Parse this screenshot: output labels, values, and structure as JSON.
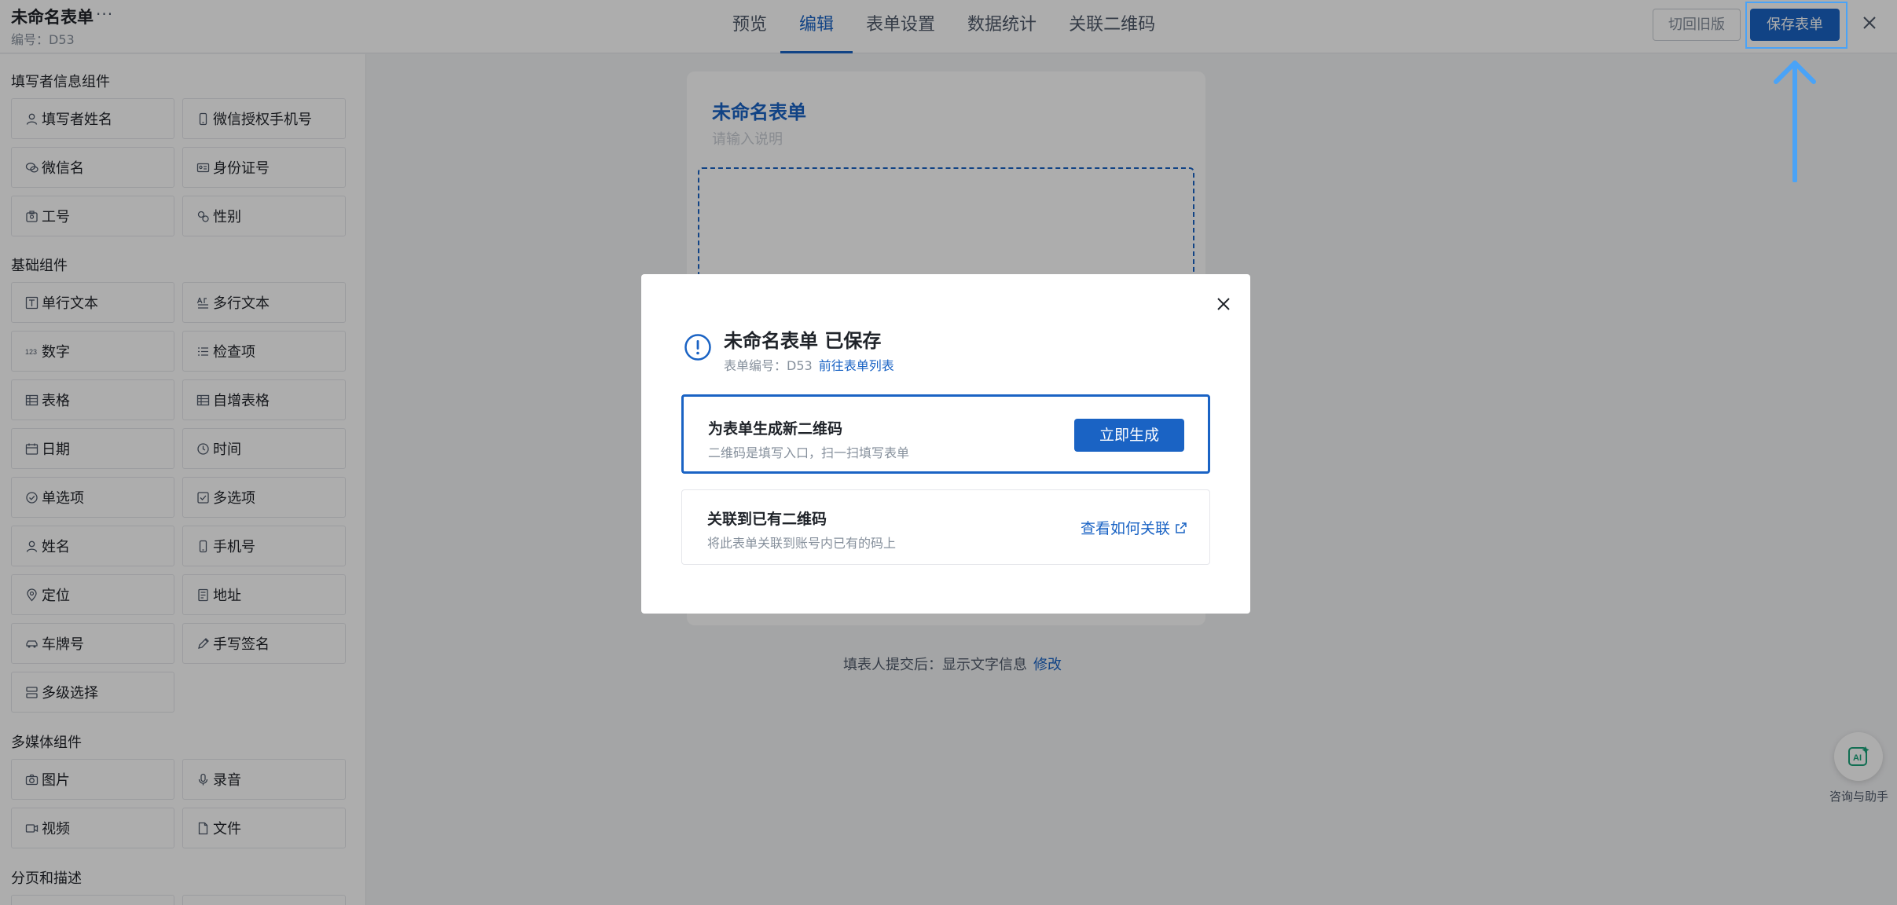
{
  "header": {
    "form_title": "未命名表单",
    "more": "···",
    "form_code": "编号：D53",
    "tabs": [
      {
        "label": "预览"
      },
      {
        "label": "编辑"
      },
      {
        "label": "表单设置"
      },
      {
        "label": "数据统计"
      },
      {
        "label": "关联二维码"
      }
    ],
    "active_tab": "编辑",
    "back_old_label": "切回旧版",
    "save_label": "保存表单"
  },
  "sidebar": {
    "sections": [
      {
        "title": "填写者信息组件",
        "items": [
          {
            "label": "填写者姓名",
            "icon": "user-icon"
          },
          {
            "label": "微信授权手机号",
            "icon": "phone-icon"
          },
          {
            "label": "微信名",
            "icon": "wechat-icon"
          },
          {
            "label": "身份证号",
            "icon": "id-card-icon"
          },
          {
            "label": "工号",
            "icon": "badge-icon"
          },
          {
            "label": "性别",
            "icon": "gender-icon"
          }
        ]
      },
      {
        "title": "基础组件",
        "items": [
          {
            "label": "单行文本",
            "icon": "text-icon"
          },
          {
            "label": "多行文本",
            "icon": "multiline-text-icon"
          },
          {
            "label": "数字",
            "icon": "number-icon"
          },
          {
            "label": "检查项",
            "icon": "checklist-icon"
          },
          {
            "label": "表格",
            "icon": "table-icon"
          },
          {
            "label": "自增表格",
            "icon": "auto-table-icon"
          },
          {
            "label": "日期",
            "icon": "calendar-icon"
          },
          {
            "label": "时间",
            "icon": "clock-icon"
          },
          {
            "label": "单选项",
            "icon": "radio-icon"
          },
          {
            "label": "多选项",
            "icon": "checkbox-icon"
          },
          {
            "label": "姓名",
            "icon": "user-icon"
          },
          {
            "label": "手机号",
            "icon": "phone-icon"
          },
          {
            "label": "定位",
            "icon": "location-icon"
          },
          {
            "label": "地址",
            "icon": "address-icon"
          },
          {
            "label": "车牌号",
            "icon": "car-icon"
          },
          {
            "label": "手写签名",
            "icon": "pen-icon"
          },
          {
            "label": "多级选择",
            "icon": "cascade-icon"
          }
        ]
      },
      {
        "title": "多媒体组件",
        "items": [
          {
            "label": "图片",
            "icon": "camera-icon"
          },
          {
            "label": "录音",
            "icon": "mic-icon"
          },
          {
            "label": "视频",
            "icon": "video-icon"
          },
          {
            "label": "文件",
            "icon": "file-icon"
          }
        ]
      },
      {
        "title": "分页和描述",
        "items": []
      }
    ]
  },
  "canvas": {
    "title": "未命名表单",
    "desc_placeholder": "请输入说明",
    "submit_note": "填表人提交后：显示文字信息",
    "submit_edit": "修改"
  },
  "assistant": {
    "label": "咨询与助手",
    "icon": "ai-icon"
  },
  "modal": {
    "title": "未命名表单 已保存",
    "sub": "表单编号：D53",
    "sub_link": "前往表单列表",
    "option1": {
      "title": "为表单生成新二维码",
      "desc": "二维码是填写入口，扫一扫填写表单",
      "button": "立即生成"
    },
    "option2": {
      "title": "关联到已有二维码",
      "desc": "将此表单关联到账号内已有的码上",
      "link": "查看如何关联"
    }
  },
  "colors": {
    "accent": "#1a63c4",
    "highlight": "#4aa3f7"
  }
}
